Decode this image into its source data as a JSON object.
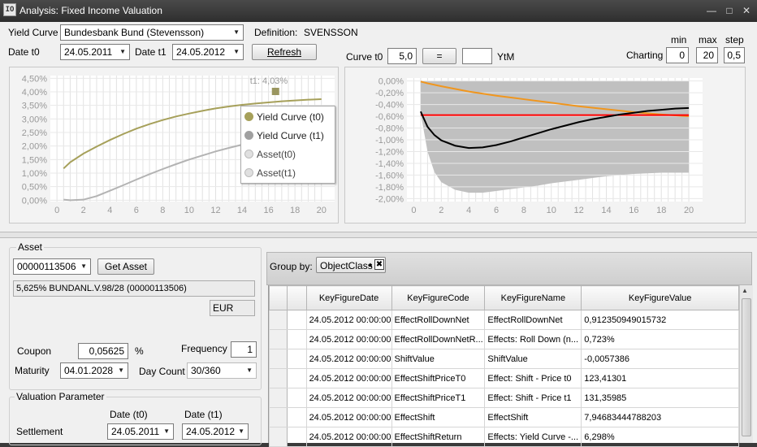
{
  "window": {
    "title": "Analysis: Fixed Income Valuation",
    "app_icon": "IO"
  },
  "header": {
    "yield_curve_label": "Yield Curve",
    "yield_curve_value": "Bundesbank Bund (Stevensson)",
    "definition_label": "Definition:",
    "definition_value": "SVENSSON",
    "date_t0_label": "Date t0",
    "date_t0_value": "24.05.2011",
    "date_t1_label": "Date t1",
    "date_t1_value": "24.05.2012",
    "refresh_label": "Refresh",
    "curve_t0_label": "Curve t0",
    "curve_t0_value": "5,0",
    "equals_label": "=",
    "ytm_value": "",
    "ytm_label": "YtM",
    "charting_label": "Charting",
    "min_label": "min",
    "max_label": "max",
    "step_label": "step",
    "min_value": "0",
    "max_value": "20",
    "step_value": "0,5"
  },
  "chart_data": [
    {
      "type": "line",
      "x_ticks": [
        "0",
        "2",
        "4",
        "6",
        "8",
        "10",
        "12",
        "14",
        "16",
        "18",
        "20"
      ],
      "y_ticks": [
        "4,50%",
        "4,00%",
        "3,50%",
        "3,00%",
        "2,50%",
        "2,00%",
        "1,50%",
        "1,00%",
        "0,50%",
        "0,00%"
      ],
      "xlim": [
        -0.5,
        21
      ],
      "ylim": [
        -0.05,
        4.6
      ],
      "series": [
        {
          "name": "Yield Curve (t0)",
          "color": "#a6a05a",
          "x": [
            0.5,
            1,
            2,
            3,
            4,
            5,
            6,
            7,
            8,
            9,
            10,
            11,
            12,
            13,
            14,
            15,
            16,
            17,
            18,
            19,
            20
          ],
          "y": [
            1.17,
            1.4,
            1.72,
            1.98,
            2.22,
            2.44,
            2.64,
            2.81,
            2.96,
            3.09,
            3.2,
            3.3,
            3.39,
            3.46,
            3.52,
            3.57,
            3.61,
            3.65,
            3.68,
            3.71,
            3.73
          ]
        },
        {
          "name": "Yield Curve (t1)",
          "color": "#b3b3b3",
          "x": [
            0.5,
            1,
            2,
            3,
            4,
            5,
            6,
            7,
            8,
            9,
            10,
            11,
            12,
            13,
            14,
            15,
            16,
            17,
            18,
            19,
            20
          ],
          "y": [
            0.02,
            0.0,
            0.02,
            0.15,
            0.35,
            0.55,
            0.76,
            0.96,
            1.15,
            1.33,
            1.5,
            1.65,
            1.8,
            1.93,
            2.05,
            2.15,
            2.24,
            2.32,
            2.39,
            2.45,
            2.5
          ]
        }
      ],
      "markers": [
        {
          "label": "t1: 4,03%",
          "x": 16.5,
          "y": 4.03,
          "color": "#9a9660"
        }
      ],
      "hidden_label": "t1:",
      "legend": {
        "placement": "right",
        "items": [
          {
            "label": "Yield Curve (t0)",
            "color": "#a6a05a",
            "active": true
          },
          {
            "label": "Yield Curve (t1)",
            "color": "#a0a0a0",
            "active": true
          },
          {
            "label": "Asset(t0)",
            "color": "#e0e0e0",
            "active": false
          },
          {
            "label": "Asset(t1)",
            "color": "#e0e0e0",
            "active": false
          }
        ]
      },
      "grid": true
    },
    {
      "type": "line",
      "x_ticks": [
        "0",
        "2",
        "4",
        "6",
        "8",
        "10",
        "12",
        "14",
        "16",
        "18",
        "20"
      ],
      "y_ticks": [
        "0,00%",
        "-0,20%",
        "-0,40%",
        "-0,60%",
        "-0,80%",
        "-1,00%",
        "-1,20%",
        "-1,40%",
        "-1,60%",
        "-1,80%",
        "-2,00%"
      ],
      "xlim": [
        -0.5,
        21
      ],
      "ylim": [
        -2.05,
        0.05
      ],
      "area": {
        "color": "#c0c0c0",
        "x": [
          0.5,
          1,
          1.5,
          2,
          3,
          4,
          5,
          6,
          7,
          8,
          9,
          10,
          11,
          12,
          13,
          14,
          15,
          16,
          17,
          18,
          19,
          20
        ],
        "y": [
          -0.55,
          -1.2,
          -1.55,
          -1.72,
          -1.85,
          -1.9,
          -1.9,
          -1.87,
          -1.84,
          -1.81,
          -1.78,
          -1.74,
          -1.71,
          -1.68,
          -1.65,
          -1.62,
          -1.6,
          -1.58,
          -1.57,
          -1.56,
          -1.56,
          -1.56
        ]
      },
      "series": [
        {
          "name": "",
          "color": "#f0961e",
          "x": [
            0.5,
            1,
            2,
            4,
            6,
            8,
            10,
            12,
            14,
            16,
            18,
            20
          ],
          "y": [
            -0.01,
            -0.04,
            -0.09,
            -0.18,
            -0.25,
            -0.31,
            -0.37,
            -0.43,
            -0.48,
            -0.53,
            -0.57,
            -0.6
          ]
        },
        {
          "name": "",
          "color": "#ff0000",
          "x": [
            0.5,
            20
          ],
          "y": [
            -0.58,
            -0.58
          ]
        },
        {
          "name": "",
          "color": "#000000",
          "x": [
            0.5,
            1,
            1.5,
            2,
            3,
            4,
            5,
            6,
            7,
            8,
            9,
            10,
            11,
            12,
            13,
            14,
            15,
            16,
            17,
            18,
            19,
            20
          ],
          "y": [
            -0.52,
            -0.78,
            -0.92,
            -1.01,
            -1.1,
            -1.14,
            -1.13,
            -1.09,
            -1.03,
            -0.96,
            -0.89,
            -0.82,
            -0.76,
            -0.7,
            -0.65,
            -0.61,
            -0.57,
            -0.54,
            -0.51,
            -0.49,
            -0.47,
            -0.46
          ]
        }
      ],
      "grid": true
    }
  ],
  "asset": {
    "group_title": "Asset",
    "id_value": "00000113506",
    "get_asset_label": "Get Asset",
    "description": "5,625% BUNDANL.V.98/28 (00000113506)",
    "currency": "EUR",
    "coupon_label": "Coupon",
    "coupon_value": "0,05625",
    "coupon_unit": "%",
    "frequency_label": "Frequency",
    "frequency_value": "1",
    "maturity_label": "Maturity",
    "maturity_value": "04.01.2028",
    "day_count_label": "Day Count",
    "day_count_value": "30/360"
  },
  "valuation": {
    "group_title": "Valuation Parameter",
    "date_t0_label": "Date (t0)",
    "date_t1_label": "Date (t1)",
    "settlement_label": "Settlement",
    "settlement_t0": "24.05.2011",
    "settlement_t1": "24.05.2012"
  },
  "grid": {
    "group_by_label": "Group by:",
    "group_chip": "ObjectClass",
    "columns": [
      "KeyFigureDate",
      "KeyFigureCode",
      "KeyFigureName",
      "KeyFigureValue"
    ],
    "rows": [
      [
        "24.05.2012 00:00:00",
        "EffectRollDownNet",
        "EffectRollDownNet",
        "0,912350949015732"
      ],
      [
        "24.05.2012 00:00:00",
        "EffectRollDownNetR...",
        "Effects: Roll Down (n...",
        "0,723%"
      ],
      [
        "24.05.2012 00:00:00",
        "ShiftValue",
        "ShiftValue",
        "-0,0057386"
      ],
      [
        "24.05.2012 00:00:00",
        "EffectShiftPriceT0",
        "Effect: Shift - Price t0",
        "123,41301"
      ],
      [
        "24.05.2012 00:00:00",
        "EffectShiftPriceT1",
        "Effect: Shift - Price t1",
        "131,35985"
      ],
      [
        "24.05.2012 00:00:00",
        "EffectShift",
        "EffectShift",
        "7,94683444788203"
      ],
      [
        "24.05.2012 00:00:00",
        "EffectShiftReturn",
        "Effects: Yield Curve -...",
        "6,298%"
      ]
    ]
  }
}
